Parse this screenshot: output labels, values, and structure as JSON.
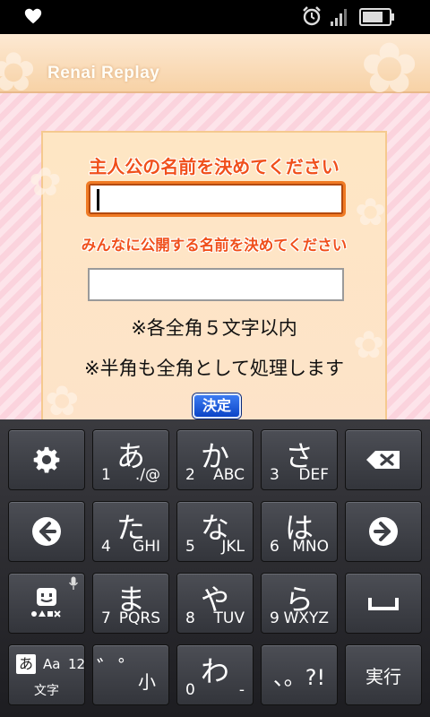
{
  "status_bar": {
    "icons": [
      "heart-icon",
      "alarm-icon",
      "signal-icon",
      "battery-icon"
    ]
  },
  "app": {
    "title": "Renai Replay",
    "heading_name": "主人公の名前を決めてください",
    "heading_public_name": "みんなに公開する名前を決めてください",
    "name_value": "",
    "public_name_value": "",
    "note_1": "※各全角５文字以内",
    "note_2": "※半角も全角として処理します",
    "ok_label": "決定"
  },
  "keyboard": {
    "rows": [
      [
        {
          "icon": "gear-icon"
        },
        {
          "main": "あ",
          "num": "1",
          "sub": "./@"
        },
        {
          "main": "か",
          "num": "2",
          "sub": "ABC"
        },
        {
          "main": "さ",
          "num": "3",
          "sub": "DEF"
        },
        {
          "icon": "backspace-icon"
        }
      ],
      [
        {
          "icon": "left-arrow-icon"
        },
        {
          "main": "た",
          "num": "4",
          "sub": "GHI"
        },
        {
          "main": "な",
          "num": "5",
          "sub": "JKL"
        },
        {
          "main": "は",
          "num": "6",
          "sub": "MNO"
        },
        {
          "icon": "right-arrow-icon"
        }
      ],
      [
        {
          "icon": "emoji-icon"
        },
        {
          "main": "ま",
          "num": "7",
          "sub": "PQRS"
        },
        {
          "main": "や",
          "num": "8",
          "sub": "TUV"
        },
        {
          "main": "ら",
          "num": "9",
          "sub": "WXYZ"
        },
        {
          "icon": "space-icon"
        }
      ],
      [
        {
          "kana": "あ",
          "aa": "Aa",
          "n12": "12",
          "label": "文字"
        },
        {
          "main": "゛゜",
          "sub": "小"
        },
        {
          "main": "わ",
          "num": "0",
          "sub": "-"
        },
        {
          "main": "、。?!"
        },
        {
          "label": "実行"
        }
      ]
    ]
  },
  "colors": {
    "heading": "#f0501c",
    "input_border_focused": "#f07a24",
    "ok_button": "#1f5fe0",
    "key_face": "#42444a"
  }
}
